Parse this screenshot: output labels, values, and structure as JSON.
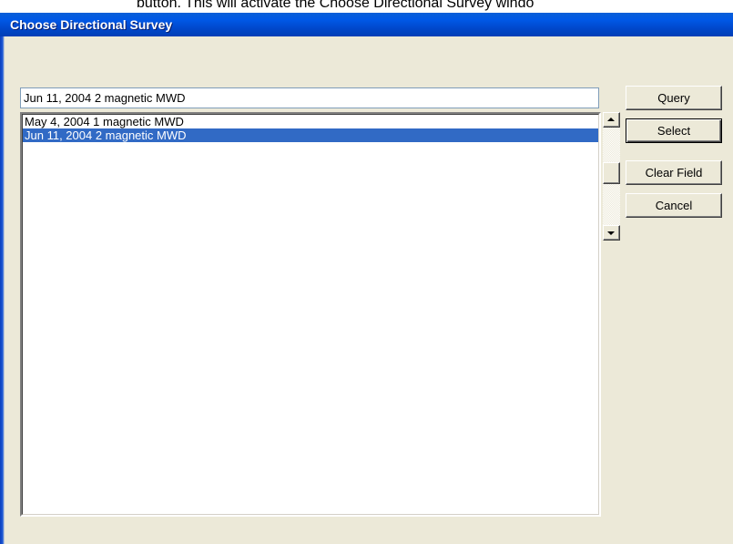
{
  "background_text": "button. This will activate the Choose Directional Survey windo",
  "window": {
    "title": "Choose Directional Survey",
    "titlebar_color": "#0054e3",
    "face_color": "#ece9d8"
  },
  "search": {
    "value": "Jun 11, 2004 2 magnetic MWD"
  },
  "list": {
    "items": [
      {
        "label": "May 4, 2004 1 magnetic MWD",
        "selected": false
      },
      {
        "label": "Jun 11, 2004 2 magnetic MWD",
        "selected": true
      }
    ],
    "selection_color": "#316ac5"
  },
  "scrollbar": {
    "up_icon": "scroll-up-arrow",
    "down_icon": "scroll-down-arrow"
  },
  "buttons": {
    "query": "Query",
    "select": "Select",
    "clear_field": "Clear Field",
    "cancel": "Cancel"
  }
}
